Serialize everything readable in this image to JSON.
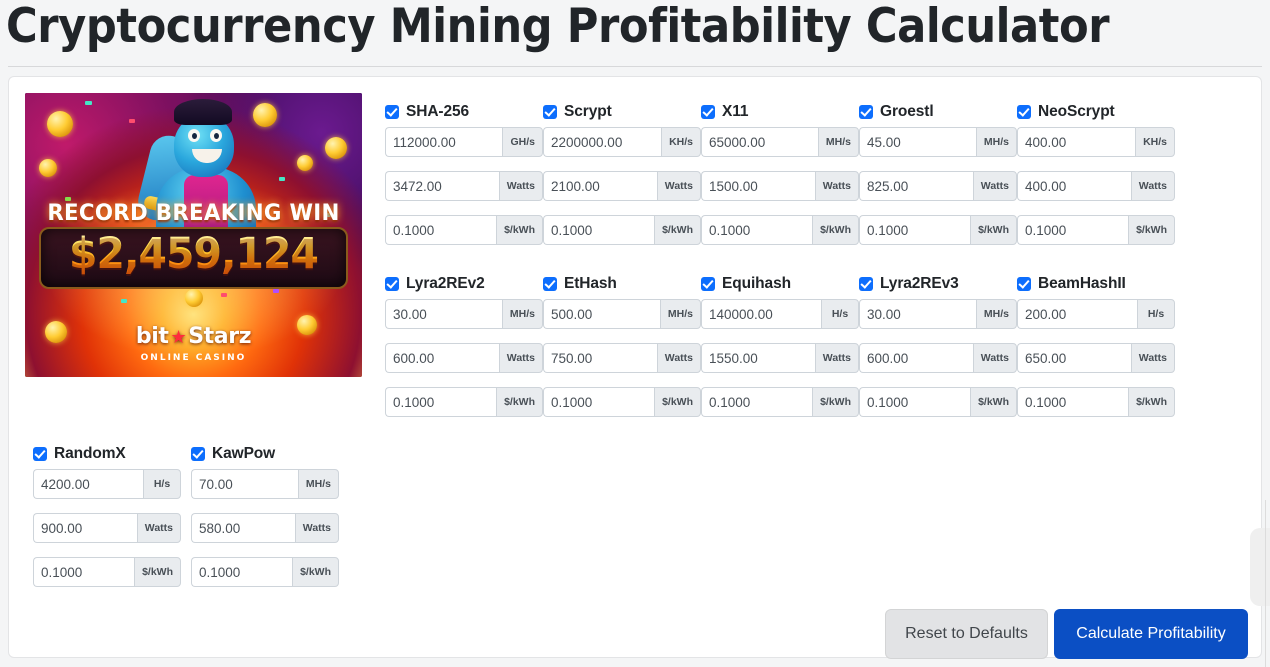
{
  "page": {
    "title": "Cryptocurrency Mining Profitability Calculator"
  },
  "ad": {
    "headline": "RECORD BREAKING WIN",
    "amount": "$2,459,124",
    "brand_left": "bit",
    "brand_right": "Starz",
    "brand_star": "★",
    "subtitle": "ONLINE CASINO"
  },
  "units": {
    "watts": "Watts",
    "cost": "$/kWh"
  },
  "algorithms_grid": [
    [
      {
        "name": "SHA-256",
        "checked": true,
        "hashrate": "112000.00",
        "hashrate_unit": "GH/s",
        "power": "3472.00",
        "power_unit": "Watts",
        "cost": "0.1000",
        "cost_unit": "$/kWh"
      },
      {
        "name": "Scrypt",
        "checked": true,
        "hashrate": "2200000.00",
        "hashrate_unit": "KH/s",
        "power": "2100.00",
        "power_unit": "Watts",
        "cost": "0.1000",
        "cost_unit": "$/kWh"
      },
      {
        "name": "X11",
        "checked": true,
        "hashrate": "65000.00",
        "hashrate_unit": "MH/s",
        "power": "1500.00",
        "power_unit": "Watts",
        "cost": "0.1000",
        "cost_unit": "$/kWh"
      },
      {
        "name": "Groestl",
        "checked": true,
        "hashrate": "45.00",
        "hashrate_unit": "MH/s",
        "power": "825.00",
        "power_unit": "Watts",
        "cost": "0.1000",
        "cost_unit": "$/kWh"
      },
      {
        "name": "NeoScrypt",
        "checked": true,
        "hashrate": "400.00",
        "hashrate_unit": "KH/s",
        "power": "400.00",
        "power_unit": "Watts",
        "cost": "0.1000",
        "cost_unit": "$/kWh"
      }
    ],
    [
      {
        "name": "Lyra2REv2",
        "checked": true,
        "hashrate": "30.00",
        "hashrate_unit": "MH/s",
        "power": "600.00",
        "power_unit": "Watts",
        "cost": "0.1000",
        "cost_unit": "$/kWh"
      },
      {
        "name": "EtHash",
        "checked": true,
        "hashrate": "500.00",
        "hashrate_unit": "MH/s",
        "power": "750.00",
        "power_unit": "Watts",
        "cost": "0.1000",
        "cost_unit": "$/kWh"
      },
      {
        "name": "Equihash",
        "checked": true,
        "hashrate": "140000.00",
        "hashrate_unit": "H/s",
        "power": "1550.00",
        "power_unit": "Watts",
        "cost": "0.1000",
        "cost_unit": "$/kWh"
      },
      {
        "name": "Lyra2REv3",
        "checked": true,
        "hashrate": "30.00",
        "hashrate_unit": "MH/s",
        "power": "600.00",
        "power_unit": "Watts",
        "cost": "0.1000",
        "cost_unit": "$/kWh"
      },
      {
        "name": "BeamHashII",
        "checked": true,
        "hashrate": "200.00",
        "hashrate_unit": "H/s",
        "power": "650.00",
        "power_unit": "Watts",
        "cost": "0.1000",
        "cost_unit": "$/kWh"
      }
    ]
  ],
  "algorithms_bottom": [
    {
      "name": "RandomX",
      "checked": true,
      "hashrate": "4200.00",
      "hashrate_unit": "H/s",
      "power": "900.00",
      "power_unit": "Watts",
      "cost": "0.1000",
      "cost_unit": "$/kWh"
    },
    {
      "name": "KawPow",
      "checked": true,
      "hashrate": "70.00",
      "hashrate_unit": "MH/s",
      "power": "580.00",
      "power_unit": "Watts",
      "cost": "0.1000",
      "cost_unit": "$/kWh"
    }
  ],
  "actions": {
    "reset_label": "Reset to Defaults",
    "calculate_label": "Calculate Profitability"
  },
  "colors": {
    "primary": "#0b4fc4",
    "checkbox": "#0d6efd",
    "secondary_button": "#e2e3e5",
    "addon_background": "#e9ecef",
    "page_background": "#f4f5f6"
  }
}
